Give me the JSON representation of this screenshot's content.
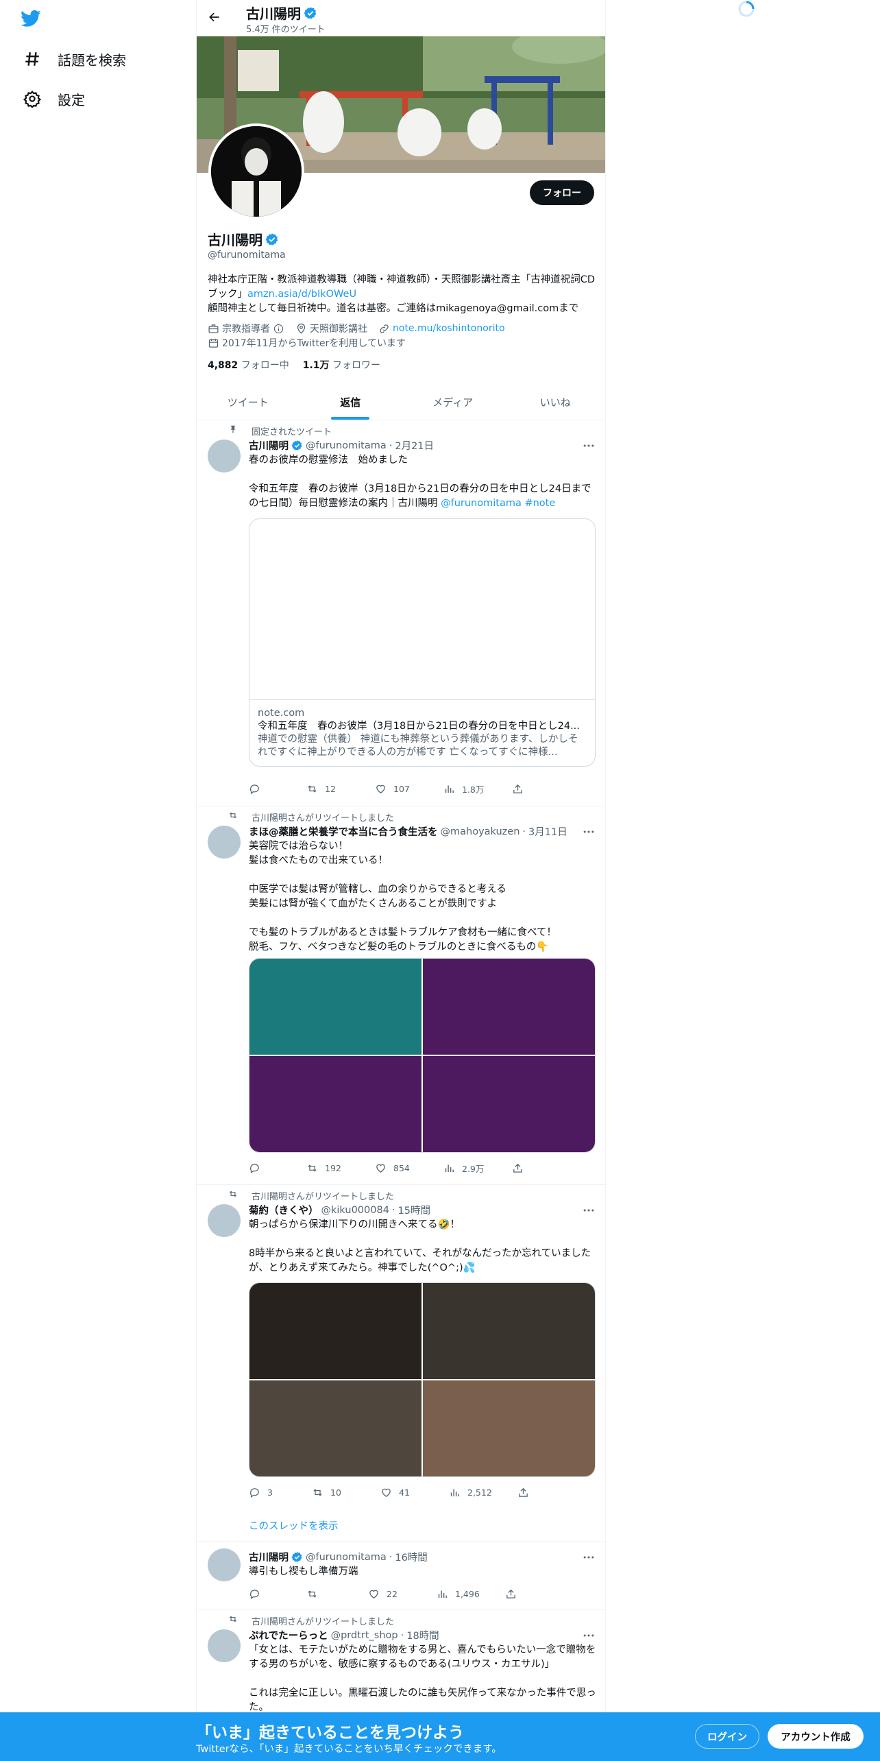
{
  "nav": {
    "explore_label": "話題を検索",
    "settings_label": "設定"
  },
  "header": {
    "name": "古川陽明",
    "tweet_count": "5.4万 件のツイート"
  },
  "profile": {
    "follow_label": "フォロー",
    "name": "古川陽明",
    "handle": "@furunomitama",
    "bio_line1": "神社本庁正階・教派神道教導職（神職・神道教師）・天照御影講社斎主「古神道祝詞CDブック」",
    "bio_link": "amzn.asia/d/bIkOWeU",
    "bio_line2": "顧問神主として毎日祈祷中。道名は基密。ご連絡はmikagenoya@gmail.comまで",
    "category": "宗教指導者",
    "location": "天照御影講社",
    "website": "note.mu/koshintonorito",
    "joined": "2017年11月からTwitterを利用しています",
    "following_count": "4,882",
    "following_label": "フォロー中",
    "followers_count": "1.1万",
    "followers_label": "フォロワー"
  },
  "tabs": [
    {
      "label": "ツイート"
    },
    {
      "label": "返信"
    },
    {
      "label": "メディア"
    },
    {
      "label": "いいね"
    }
  ],
  "tweets": [
    {
      "context": "固定されたツイート",
      "name": "古川陽明",
      "handle": "@furunomitama",
      "time": "2月21日",
      "text": "春のお彼岸の慰霊修法　始めました\n\n令和五年度　春のお彼岸（3月18日から21日の春分の日を中日とし24日までの七日間）毎日慰霊修法の案内｜古川陽明 ",
      "mention": "@furunomitama",
      "hashtag": "#note",
      "card_domain": "note.com",
      "card_title": "令和五年度　春のお彼岸（3月18日から21日の春分の日を中日とし24...",
      "card_desc": "神道での慰霊（供養） 神道にも神葬祭という葬儀があります、しかしそれですぐに神上がりできる人の方が稀です 亡くなってすぐに神様...",
      "replies": "",
      "retweets": "12",
      "likes": "107",
      "views": "1.8万"
    },
    {
      "context": "古川陽明さんがリツイートしました",
      "name": "まほ@薬膳と栄養学で本当に合う食生活を",
      "handle": "@mahoyakuzen",
      "time": "3月11日",
      "text": "美容院では治らない！\n髪は食べたもので出来ている！\n\n中医学では髪は腎が管轄し、血の余りからできると考える\n美髪には腎が強くて血がたくさんあることが鉄則ですよ\n\nでも髪のトラブルがあるときは髪トラブルケア食材も一緒に食べて！\n脱毛、フケ、ベタつきなど髪の毛のトラブルのときに食べるもの👇",
      "replies": "",
      "retweets": "192",
      "likes": "854",
      "views": "2.9万"
    },
    {
      "context": "古川陽明さんがリツイートしました",
      "name": "菊約（きくや）",
      "handle": "@kiku000084",
      "time": "15時間",
      "text": "朝っぱらから保津川下りの川開きへ来てる🤣！\n\n8時半から来ると良いよと言われていて、それがなんだったか忘れていましたが、とりあえず来てみたら。神事でした(^O^;)💦",
      "replies": "3",
      "retweets": "10",
      "likes": "41",
      "views": "2,512",
      "thread_link": "このスレッドを表示"
    },
    {
      "context": "",
      "name": "古川陽明",
      "handle": "@furunomitama",
      "time": "16時間",
      "text": "導引もし禊もし準備万端",
      "replies": "",
      "retweets": "",
      "likes": "22",
      "views": "1,496"
    },
    {
      "context": "古川陽明さんがリツイートしました",
      "name": "ぷれでたーらっと",
      "handle": "@prdtrt_shop",
      "time": "18時間",
      "text": "「女とは、モテたいがために贈物をする男と、喜んでもらいたい一念で贈物をする男のちがいを、敏感に察するものである(ユリウス・カエサル)」\n\nこれは完全に正しい。黒曜石渡したのに誰も矢尻作って来なかった事件で思った。"
    }
  ],
  "bottom_bar": {
    "title": "「いま」起きていることを見つけよう",
    "subtitle": "Twitterなら、「いま」起きていることをいち早くチェックできます。",
    "login_label": "ログイン",
    "signup_label": "アカウント作成"
  },
  "colors": {
    "accent": "#1d9bf0",
    "text": "#0f1419",
    "muted": "#536471",
    "grid1": [
      "#1b7a7b",
      "#4e1a5f",
      "#4e1a5f",
      "#4e1a5f"
    ],
    "grid2": [
      "#28221e",
      "#3a342e",
      "#4f463d",
      "#7a604c"
    ]
  }
}
